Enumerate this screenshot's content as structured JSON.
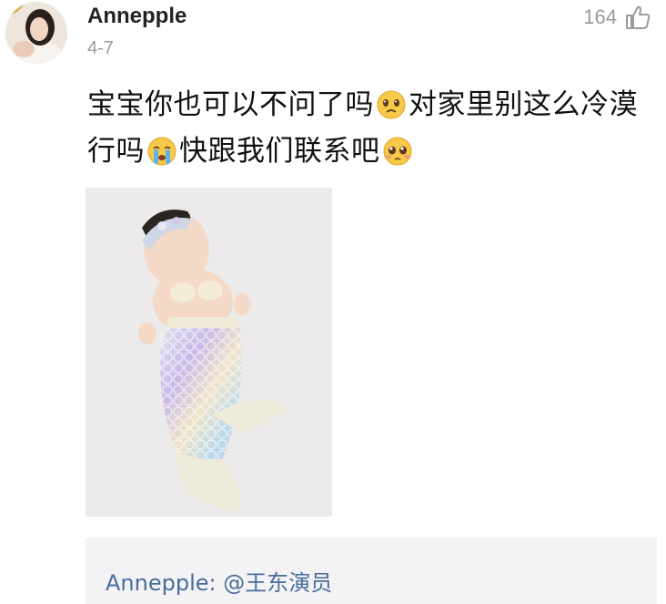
{
  "comment": {
    "username": "Annepple",
    "date": "4-7",
    "like_count": "164",
    "text_segments": [
      {
        "type": "text",
        "value": "宝宝你也可以不问了吗"
      },
      {
        "type": "emoji",
        "icon": "sad-face-emoji"
      },
      {
        "type": "text",
        "value": "对家里别这么冷漠行吗"
      },
      {
        "type": "emoji",
        "icon": "crying-face-emoji"
      },
      {
        "type": "text",
        "value": "快跟我们联系吧"
      },
      {
        "type": "emoji",
        "icon": "pleading-face-emoji"
      }
    ]
  },
  "reply": {
    "author": "Annepple:",
    "mention": "@王东演员"
  },
  "colors": {
    "link": "#4a6c9b",
    "meta_gray": "#9a9a9a",
    "reply_bg": "#f3f3f5"
  }
}
